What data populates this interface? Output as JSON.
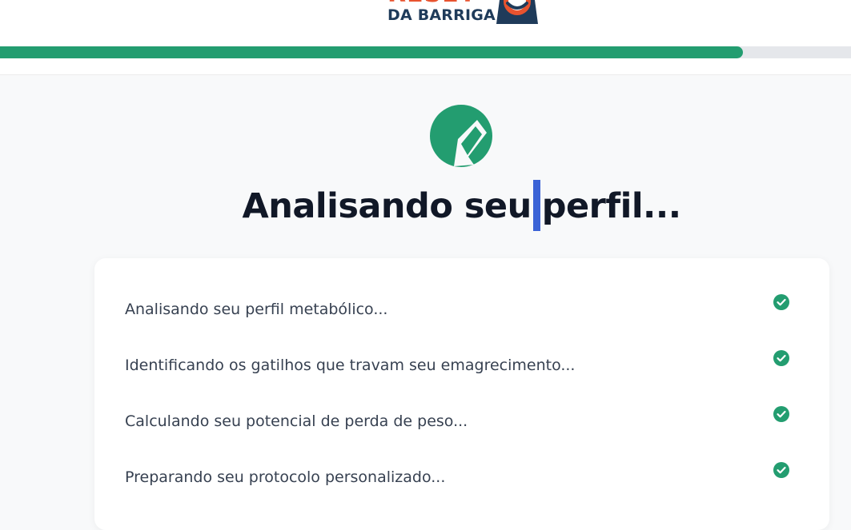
{
  "brand": {
    "logo_top": "RESET",
    "logo_bottom": "DA BARRIGA",
    "colors": {
      "accent": "#239d70",
      "logo_orange": "#e8532f",
      "logo_navy": "#1f3b5a",
      "cursor": "#3b63d6",
      "track": "#e5e7eb"
    }
  },
  "progress": {
    "fraction": 0.873
  },
  "main": {
    "icon": "pie-chart-k-icon",
    "title_before_cursor": "Analisando seu",
    "title_after_cursor": "perfil..."
  },
  "steps": [
    {
      "label": "Analisando seu perfil metabólico...",
      "status": "done",
      "icon": "check-circle-icon"
    },
    {
      "label": "Identificando os gatilhos que travam seu emagrecimento...",
      "status": "done",
      "icon": "check-circle-icon"
    },
    {
      "label": "Calculando seu potencial de perda de peso...",
      "status": "done",
      "icon": "check-circle-icon"
    },
    {
      "label": "Preparando seu protocolo personalizado...",
      "status": "done",
      "icon": "check-circle-icon"
    }
  ]
}
